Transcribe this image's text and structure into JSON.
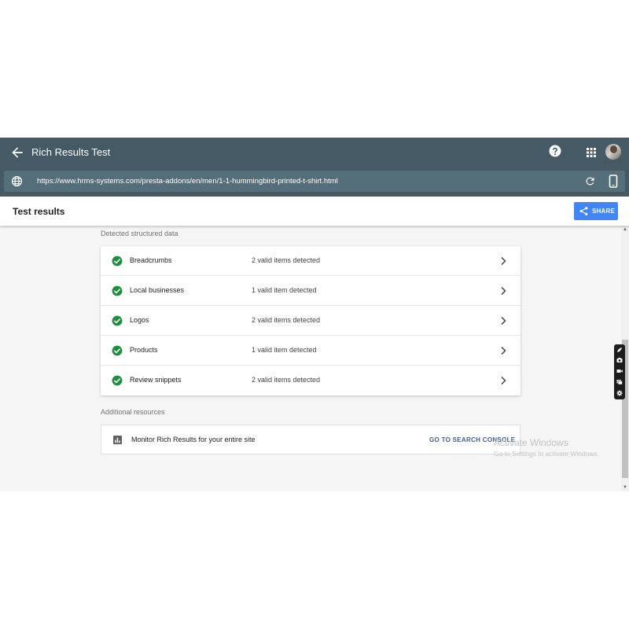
{
  "header": {
    "title": "Rich Results Test"
  },
  "url_bar": {
    "url": "https://www.hrms-systems.com/presta-addons/en/men/1-1-hummingbird-printed-t-shirt.html"
  },
  "results_bar": {
    "title": "Test results",
    "share_label": "SHARE"
  },
  "structured_data": {
    "section_title": "Detected structured data",
    "items": [
      {
        "name": "Breadcrumbs",
        "status": "2 valid items detected"
      },
      {
        "name": "Local businesses",
        "status": "1 valid item detected"
      },
      {
        "name": "Logos",
        "status": "2 valid items detected"
      },
      {
        "name": "Products",
        "status": "1 valid item detected"
      },
      {
        "name": "Review snippets",
        "status": "2 valid items detected"
      }
    ]
  },
  "resources": {
    "section_title": "Additional resources",
    "monitor_text": "Monitor Rich Results for your entire site",
    "link_label": "GO TO SEARCH CONSOLE"
  },
  "watermark": {
    "title": "Activate Windows",
    "subtitle": "Go to Settings to activate Windows."
  },
  "icons": {
    "back": "arrow-back-icon",
    "help": "help-icon",
    "apps": "apps-grid-icon",
    "globe": "globe-icon",
    "reload": "reload-icon",
    "device": "smartphone-icon",
    "share": "share-icon",
    "check": "check-circle-icon",
    "chevron": "chevron-right-icon",
    "chart": "bar-chart-icon"
  },
  "colors": {
    "header_bg": "#455a64",
    "url_bar_bg": "#546e7a",
    "accent": "#4285f4",
    "valid_green": "#1e8e3e",
    "link": "#3f5f8f"
  }
}
